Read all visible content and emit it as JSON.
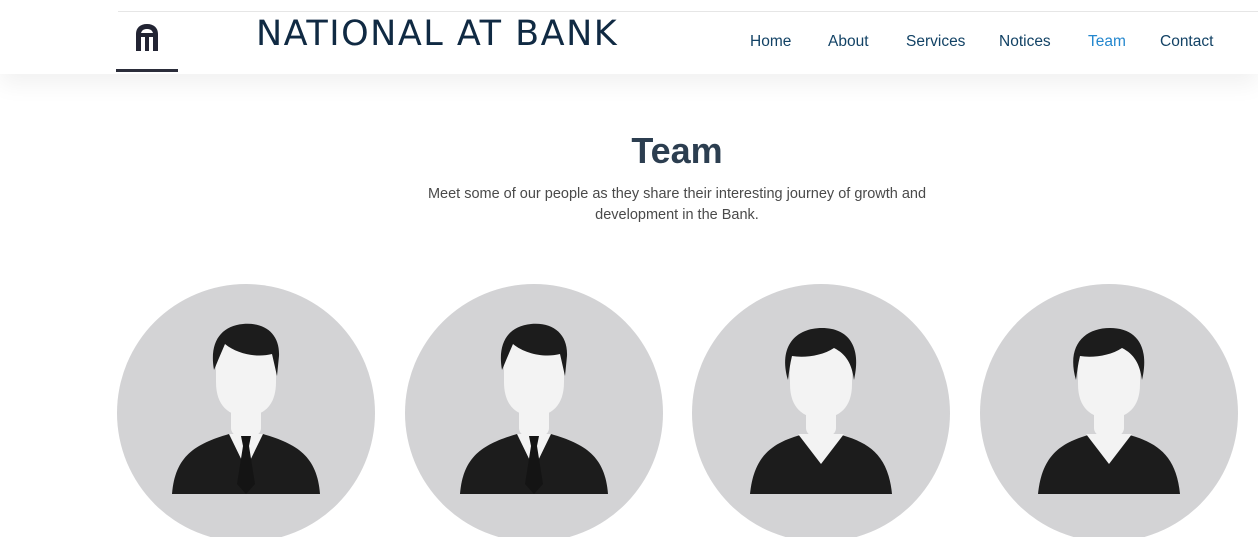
{
  "brand": {
    "name": "NATIONAL AT BANK",
    "logo_icon": "helmet-logo-icon"
  },
  "nav": {
    "items": [
      {
        "label": "Home",
        "active": false
      },
      {
        "label": "About",
        "active": false
      },
      {
        "label": "Services",
        "active": false
      },
      {
        "label": "Notices",
        "active": false
      },
      {
        "label": "Team",
        "active": true
      },
      {
        "label": "Contact",
        "active": false
      }
    ]
  },
  "team_section": {
    "title": "Team",
    "subtitle_line1": "Meet some of our people as they share their interesting journey of growth and",
    "subtitle_line2": "development in the Bank.",
    "members": [
      {
        "avatar": "male-avatar-icon"
      },
      {
        "avatar": "male-avatar-icon"
      },
      {
        "avatar": "female-avatar-icon"
      },
      {
        "avatar": "female-avatar-icon"
      }
    ]
  },
  "colors": {
    "nav_text": "#124265",
    "nav_active": "#2487ce",
    "title": "#2c3e50",
    "avatar_bg": "#d3d3d5",
    "silhouette": "#1c1c1c"
  }
}
